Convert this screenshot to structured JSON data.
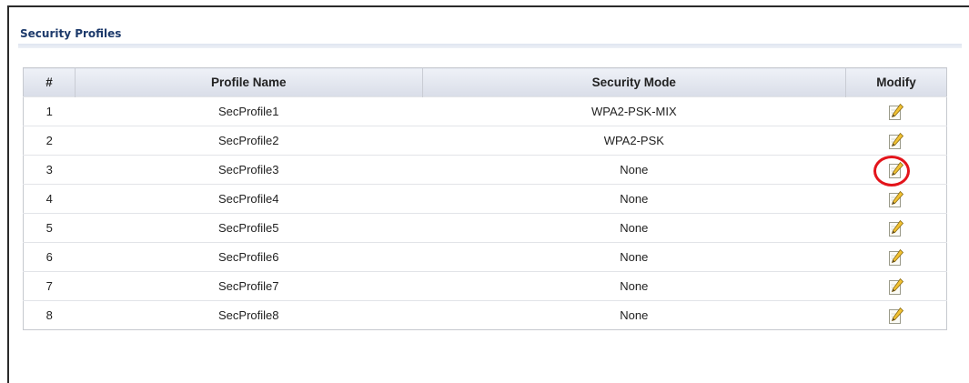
{
  "section": {
    "title": "Security Profiles"
  },
  "table": {
    "columns": [
      "#",
      "Profile Name",
      "Security Mode",
      "Modify"
    ],
    "rows": [
      {
        "num": "1",
        "name": "SecProfile1",
        "mode": "WPA2-PSK-MIX"
      },
      {
        "num": "2",
        "name": "SecProfile2",
        "mode": "WPA2-PSK"
      },
      {
        "num": "3",
        "name": "SecProfile3",
        "mode": "None"
      },
      {
        "num": "4",
        "name": "SecProfile4",
        "mode": "None"
      },
      {
        "num": "5",
        "name": "SecProfile5",
        "mode": "None"
      },
      {
        "num": "6",
        "name": "SecProfile6",
        "mode": "None"
      },
      {
        "num": "7",
        "name": "SecProfile7",
        "mode": "None"
      },
      {
        "num": "8",
        "name": "SecProfile8",
        "mode": "None"
      }
    ],
    "modify_icon": "edit-pencil-icon",
    "highlighted_row": 3
  },
  "colors": {
    "title": "#1d3a6b",
    "highlight_ring": "#e3141b",
    "header_bg": "#d9dde8"
  }
}
